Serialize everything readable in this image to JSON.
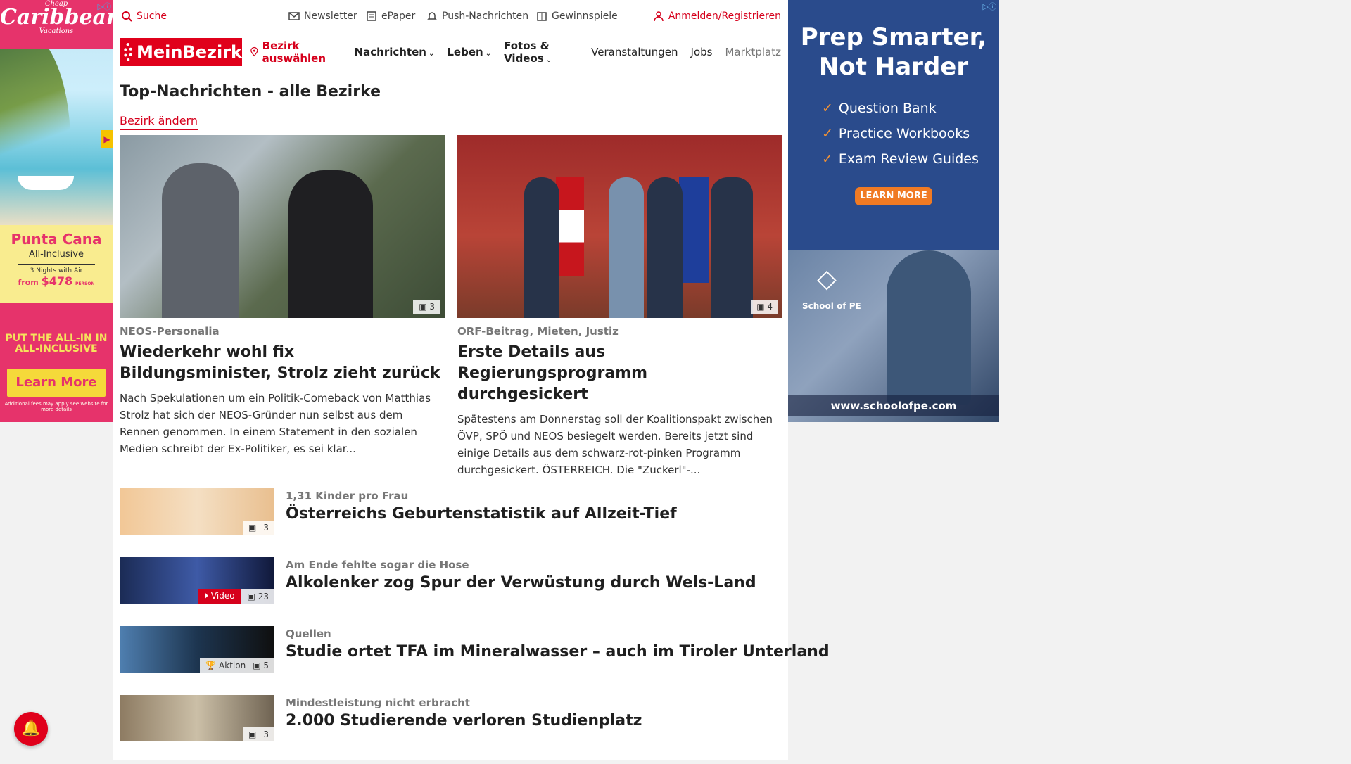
{
  "ad_left": {
    "logo_line1": "Cheap",
    "logo_line2": "Caribbean",
    "logo_line3": "Vacations",
    "destination": "Punta Cana",
    "package": "All-Inclusive",
    "nights": "3 Nights with Air",
    "price_from": "from",
    "price": "$478",
    "price_unit": "PERSON",
    "tagline": "PUT THE ALL-IN IN ALL-INCLUSIVE",
    "cta": "Learn More",
    "fees": "Additional fees may apply see website for more details"
  },
  "ad_right": {
    "headline": "Prep Smarter, Not Harder",
    "items": [
      "Question Bank",
      "Practice Workbooks",
      "Exam Review Guides"
    ],
    "cta": "LEARN MORE",
    "brand": "School of PE",
    "url": "www.schoolofpe.com"
  },
  "topbar": {
    "search": "Suche",
    "newsletter": "Newsletter",
    "epaper": "ePaper",
    "push": "Push-Nachrichten",
    "gewinnspiele": "Gewinnspiele",
    "login": "Anmelden/Registrieren"
  },
  "nav": {
    "brand": "MeinBezirk",
    "location": "Bezirk auswählen",
    "items": [
      "Nachrichten",
      "Leben",
      "Fotos & Videos",
      "Veranstaltungen",
      "Jobs",
      "Marktplatz"
    ]
  },
  "page": {
    "title": "Top-Nachrichten - alle Bezirke",
    "change_link": "Bezirk ändern"
  },
  "cards": [
    {
      "count": "3",
      "kicker": "NEOS-Personalia",
      "headline": "Wiederkehr wohl fix Bildungsminister, Strolz zieht zurück",
      "teaser": "Nach Spekulationen um ein Politik-Comeback von Matthias Strolz hat sich der NEOS-Gründer nun selbst aus dem Rennen genommen. In einem Statement in den sozialen Medien schreibt der Ex-Politiker, es sei klar..."
    },
    {
      "count": "4",
      "kicker": "ORF-Beitrag, Mieten, Justiz",
      "headline": "Erste Details aus Regierungsprogramm durchgesickert",
      "teaser": "Spätestens am Donnerstag soll der Koalitionspakt zwischen ÖVP, SPÖ und NEOS besiegelt werden. Bereits jetzt sind einige Details aus dem schwarz-rot-pinken Programm durchgesickert.  ÖSTERREICH. Die \"Zuckerl\"-..."
    }
  ],
  "list": [
    {
      "kicker": "1,31 Kinder pro Frau",
      "headline": "Österreichs Geburtenstatistik auf Allzeit-Tief",
      "count": "3"
    },
    {
      "kicker": "Am Ende fehlte sogar die Hose",
      "headline": "Alkolenker zog Spur der Verwüstung durch Wels-Land",
      "count": "23",
      "video": "Video"
    },
    {
      "kicker": "Quellen",
      "headline": "Studie ortet TFA im Mineralwasser – auch im Tiroler Unterland",
      "count": "5",
      "aktion": "Aktion"
    },
    {
      "kicker": "Mindestleistung nicht erbracht",
      "headline": "2.000 Studierende verloren Studienplatz",
      "count": "3"
    }
  ]
}
